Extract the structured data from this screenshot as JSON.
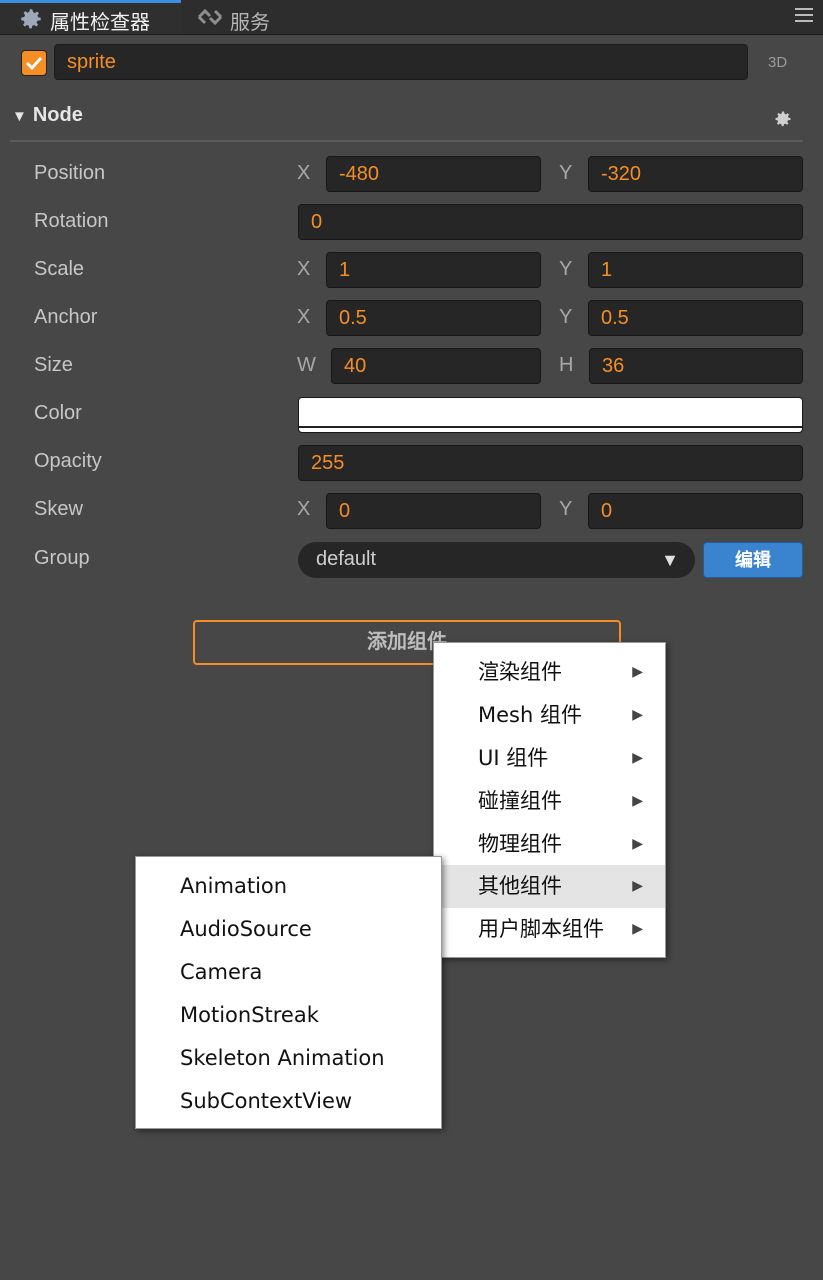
{
  "tabs": [
    {
      "label": "属性检查器",
      "icon": "gear-icon",
      "active": true
    },
    {
      "label": "服务",
      "icon": "link-icon",
      "active": false
    }
  ],
  "node": {
    "enabled": true,
    "name": "sprite",
    "mode_label": "3D"
  },
  "section": {
    "title": "Node",
    "icon": "gear-icon"
  },
  "props": {
    "position": {
      "label": "Position",
      "x_label": "X",
      "x": "-480",
      "y_label": "Y",
      "y": "-320"
    },
    "rotation": {
      "label": "Rotation",
      "value": "0"
    },
    "scale": {
      "label": "Scale",
      "x_label": "X",
      "x": "1",
      "y_label": "Y",
      "y": "1"
    },
    "anchor": {
      "label": "Anchor",
      "x_label": "X",
      "x": "0.5",
      "y_label": "Y",
      "y": "0.5"
    },
    "size": {
      "label": "Size",
      "w_label": "W",
      "w": "40",
      "h_label": "H",
      "h": "36"
    },
    "color": {
      "label": "Color",
      "value": "#ffffff"
    },
    "opacity": {
      "label": "Opacity",
      "value": "255"
    },
    "skew": {
      "label": "Skew",
      "x_label": "X",
      "x": "0",
      "y_label": "Y",
      "y": "0"
    },
    "group": {
      "label": "Group",
      "value": "default",
      "edit_label": "编辑"
    }
  },
  "add_component_label": "添加组件",
  "menu": {
    "items": [
      {
        "label": "渲染组件"
      },
      {
        "label": "Mesh 组件"
      },
      {
        "label": "UI 组件"
      },
      {
        "label": "碰撞组件"
      },
      {
        "label": "物理组件"
      },
      {
        "label": "其他组件",
        "highlighted": true
      },
      {
        "label": "用户脚本组件"
      }
    ],
    "submenu": [
      {
        "label": "Animation"
      },
      {
        "label": "AudioSource"
      },
      {
        "label": "Camera"
      },
      {
        "label": "MotionStreak"
      },
      {
        "label": "Skeleton Animation"
      },
      {
        "label": "SubContextView"
      }
    ]
  },
  "colors": {
    "accent": "#f58e24",
    "tab_active": "#3c8fde",
    "edit_button": "#3a83cf"
  }
}
